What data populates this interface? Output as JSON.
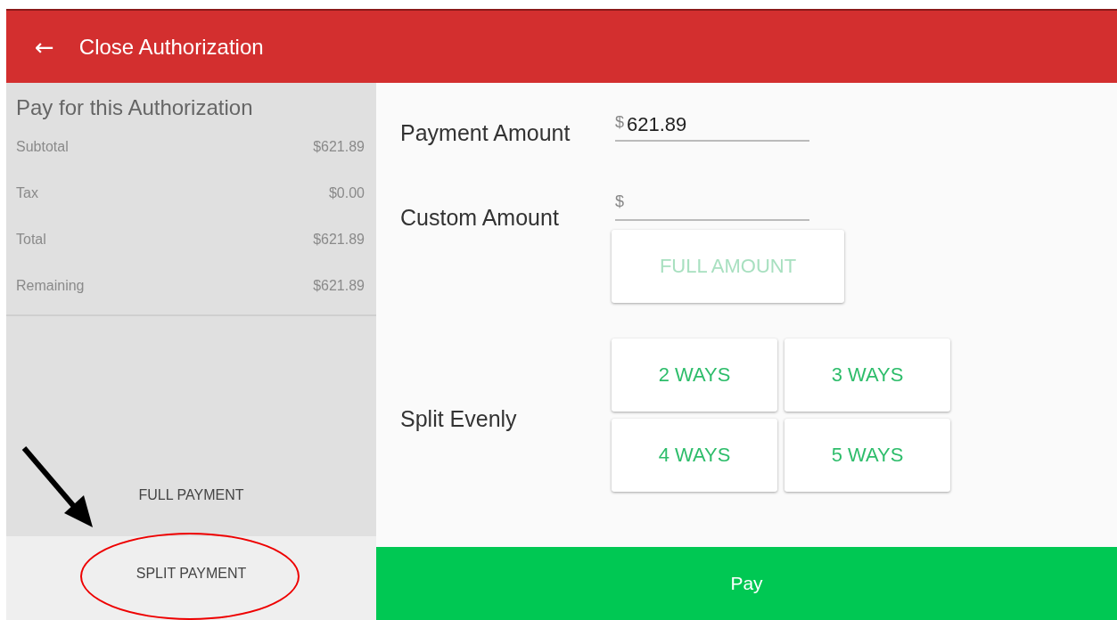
{
  "header": {
    "title": "Close Authorization",
    "back_icon": "←"
  },
  "summary": {
    "title": "Pay for this Authorization",
    "rows": [
      {
        "label": "Subtotal",
        "value": "$621.89"
      },
      {
        "label": "Tax",
        "value": "$0.00"
      },
      {
        "label": "Total",
        "value": "$621.89"
      },
      {
        "label": "Remaining",
        "value": "$621.89"
      }
    ]
  },
  "payment_tabs": [
    {
      "label": "FULL PAYMENT",
      "selected": false
    },
    {
      "label": "SPLIT PAYMENT",
      "selected": true
    }
  ],
  "payment_amount": {
    "label": "Payment Amount",
    "prefix": "$",
    "value": "621.89"
  },
  "custom_amount": {
    "label": "Custom Amount",
    "prefix": "$"
  },
  "full_amount_button": {
    "label": "FULL AMOUNT",
    "disabled": true
  },
  "split_evenly": {
    "label": "Split Evenly",
    "options": [
      {
        "label": "2 WAYS"
      },
      {
        "label": "3 WAYS"
      },
      {
        "label": "4 WAYS"
      },
      {
        "label": "5 WAYS"
      }
    ]
  },
  "pay_button": {
    "label": "Pay"
  }
}
